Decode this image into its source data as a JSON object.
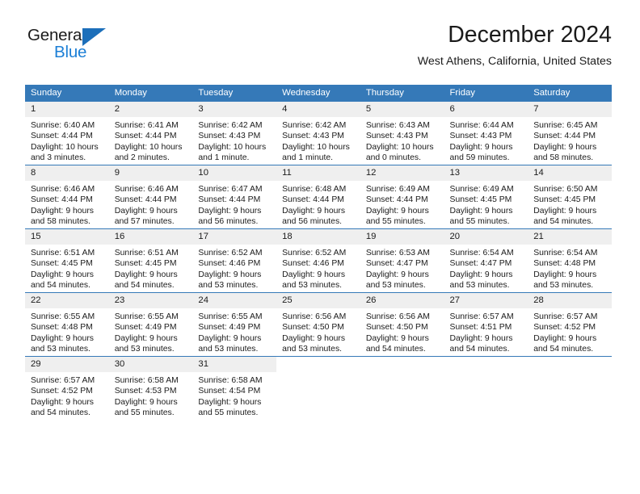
{
  "brand": {
    "name_top": "General",
    "name_bottom": "Blue",
    "triangle_color": "#1c6fba",
    "blue_text_color": "#1c7fd6"
  },
  "header": {
    "title": "December 2024",
    "subtitle": "West Athens, California, United States"
  },
  "theme": {
    "header_row_bg": "#3579b8",
    "header_row_text": "#ffffff",
    "day_number_bg": "#efefef",
    "row_divider": "#3579b8",
    "body_text": "#1b1b1b"
  },
  "weekday_headers": [
    "Sunday",
    "Monday",
    "Tuesday",
    "Wednesday",
    "Thursday",
    "Friday",
    "Saturday"
  ],
  "weeks": [
    [
      {
        "day": "1",
        "sunrise": "Sunrise: 6:40 AM",
        "sunset": "Sunset: 4:44 PM",
        "daylight1": "Daylight: 10 hours",
        "daylight2": "and 3 minutes."
      },
      {
        "day": "2",
        "sunrise": "Sunrise: 6:41 AM",
        "sunset": "Sunset: 4:44 PM",
        "daylight1": "Daylight: 10 hours",
        "daylight2": "and 2 minutes."
      },
      {
        "day": "3",
        "sunrise": "Sunrise: 6:42 AM",
        "sunset": "Sunset: 4:43 PM",
        "daylight1": "Daylight: 10 hours",
        "daylight2": "and 1 minute."
      },
      {
        "day": "4",
        "sunrise": "Sunrise: 6:42 AM",
        "sunset": "Sunset: 4:43 PM",
        "daylight1": "Daylight: 10 hours",
        "daylight2": "and 1 minute."
      },
      {
        "day": "5",
        "sunrise": "Sunrise: 6:43 AM",
        "sunset": "Sunset: 4:43 PM",
        "daylight1": "Daylight: 10 hours",
        "daylight2": "and 0 minutes."
      },
      {
        "day": "6",
        "sunrise": "Sunrise: 6:44 AM",
        "sunset": "Sunset: 4:43 PM",
        "daylight1": "Daylight: 9 hours",
        "daylight2": "and 59 minutes."
      },
      {
        "day": "7",
        "sunrise": "Sunrise: 6:45 AM",
        "sunset": "Sunset: 4:44 PM",
        "daylight1": "Daylight: 9 hours",
        "daylight2": "and 58 minutes."
      }
    ],
    [
      {
        "day": "8",
        "sunrise": "Sunrise: 6:46 AM",
        "sunset": "Sunset: 4:44 PM",
        "daylight1": "Daylight: 9 hours",
        "daylight2": "and 58 minutes."
      },
      {
        "day": "9",
        "sunrise": "Sunrise: 6:46 AM",
        "sunset": "Sunset: 4:44 PM",
        "daylight1": "Daylight: 9 hours",
        "daylight2": "and 57 minutes."
      },
      {
        "day": "10",
        "sunrise": "Sunrise: 6:47 AM",
        "sunset": "Sunset: 4:44 PM",
        "daylight1": "Daylight: 9 hours",
        "daylight2": "and 56 minutes."
      },
      {
        "day": "11",
        "sunrise": "Sunrise: 6:48 AM",
        "sunset": "Sunset: 4:44 PM",
        "daylight1": "Daylight: 9 hours",
        "daylight2": "and 56 minutes."
      },
      {
        "day": "12",
        "sunrise": "Sunrise: 6:49 AM",
        "sunset": "Sunset: 4:44 PM",
        "daylight1": "Daylight: 9 hours",
        "daylight2": "and 55 minutes."
      },
      {
        "day": "13",
        "sunrise": "Sunrise: 6:49 AM",
        "sunset": "Sunset: 4:45 PM",
        "daylight1": "Daylight: 9 hours",
        "daylight2": "and 55 minutes."
      },
      {
        "day": "14",
        "sunrise": "Sunrise: 6:50 AM",
        "sunset": "Sunset: 4:45 PM",
        "daylight1": "Daylight: 9 hours",
        "daylight2": "and 54 minutes."
      }
    ],
    [
      {
        "day": "15",
        "sunrise": "Sunrise: 6:51 AM",
        "sunset": "Sunset: 4:45 PM",
        "daylight1": "Daylight: 9 hours",
        "daylight2": "and 54 minutes."
      },
      {
        "day": "16",
        "sunrise": "Sunrise: 6:51 AM",
        "sunset": "Sunset: 4:45 PM",
        "daylight1": "Daylight: 9 hours",
        "daylight2": "and 54 minutes."
      },
      {
        "day": "17",
        "sunrise": "Sunrise: 6:52 AM",
        "sunset": "Sunset: 4:46 PM",
        "daylight1": "Daylight: 9 hours",
        "daylight2": "and 53 minutes."
      },
      {
        "day": "18",
        "sunrise": "Sunrise: 6:52 AM",
        "sunset": "Sunset: 4:46 PM",
        "daylight1": "Daylight: 9 hours",
        "daylight2": "and 53 minutes."
      },
      {
        "day": "19",
        "sunrise": "Sunrise: 6:53 AM",
        "sunset": "Sunset: 4:47 PM",
        "daylight1": "Daylight: 9 hours",
        "daylight2": "and 53 minutes."
      },
      {
        "day": "20",
        "sunrise": "Sunrise: 6:54 AM",
        "sunset": "Sunset: 4:47 PM",
        "daylight1": "Daylight: 9 hours",
        "daylight2": "and 53 minutes."
      },
      {
        "day": "21",
        "sunrise": "Sunrise: 6:54 AM",
        "sunset": "Sunset: 4:48 PM",
        "daylight1": "Daylight: 9 hours",
        "daylight2": "and 53 minutes."
      }
    ],
    [
      {
        "day": "22",
        "sunrise": "Sunrise: 6:55 AM",
        "sunset": "Sunset: 4:48 PM",
        "daylight1": "Daylight: 9 hours",
        "daylight2": "and 53 minutes."
      },
      {
        "day": "23",
        "sunrise": "Sunrise: 6:55 AM",
        "sunset": "Sunset: 4:49 PM",
        "daylight1": "Daylight: 9 hours",
        "daylight2": "and 53 minutes."
      },
      {
        "day": "24",
        "sunrise": "Sunrise: 6:55 AM",
        "sunset": "Sunset: 4:49 PM",
        "daylight1": "Daylight: 9 hours",
        "daylight2": "and 53 minutes."
      },
      {
        "day": "25",
        "sunrise": "Sunrise: 6:56 AM",
        "sunset": "Sunset: 4:50 PM",
        "daylight1": "Daylight: 9 hours",
        "daylight2": "and 53 minutes."
      },
      {
        "day": "26",
        "sunrise": "Sunrise: 6:56 AM",
        "sunset": "Sunset: 4:50 PM",
        "daylight1": "Daylight: 9 hours",
        "daylight2": "and 54 minutes."
      },
      {
        "day": "27",
        "sunrise": "Sunrise: 6:57 AM",
        "sunset": "Sunset: 4:51 PM",
        "daylight1": "Daylight: 9 hours",
        "daylight2": "and 54 minutes."
      },
      {
        "day": "28",
        "sunrise": "Sunrise: 6:57 AM",
        "sunset": "Sunset: 4:52 PM",
        "daylight1": "Daylight: 9 hours",
        "daylight2": "and 54 minutes."
      }
    ],
    [
      {
        "day": "29",
        "sunrise": "Sunrise: 6:57 AM",
        "sunset": "Sunset: 4:52 PM",
        "daylight1": "Daylight: 9 hours",
        "daylight2": "and 54 minutes."
      },
      {
        "day": "30",
        "sunrise": "Sunrise: 6:58 AM",
        "sunset": "Sunset: 4:53 PM",
        "daylight1": "Daylight: 9 hours",
        "daylight2": "and 55 minutes."
      },
      {
        "day": "31",
        "sunrise": "Sunrise: 6:58 AM",
        "sunset": "Sunset: 4:54 PM",
        "daylight1": "Daylight: 9 hours",
        "daylight2": "and 55 minutes."
      },
      {
        "day": "",
        "sunrise": "",
        "sunset": "",
        "daylight1": "",
        "daylight2": "",
        "blank": true
      },
      {
        "day": "",
        "sunrise": "",
        "sunset": "",
        "daylight1": "",
        "daylight2": "",
        "blank": true
      },
      {
        "day": "",
        "sunrise": "",
        "sunset": "",
        "daylight1": "",
        "daylight2": "",
        "blank": true
      },
      {
        "day": "",
        "sunrise": "",
        "sunset": "",
        "daylight1": "",
        "daylight2": "",
        "blank": true
      }
    ]
  ]
}
